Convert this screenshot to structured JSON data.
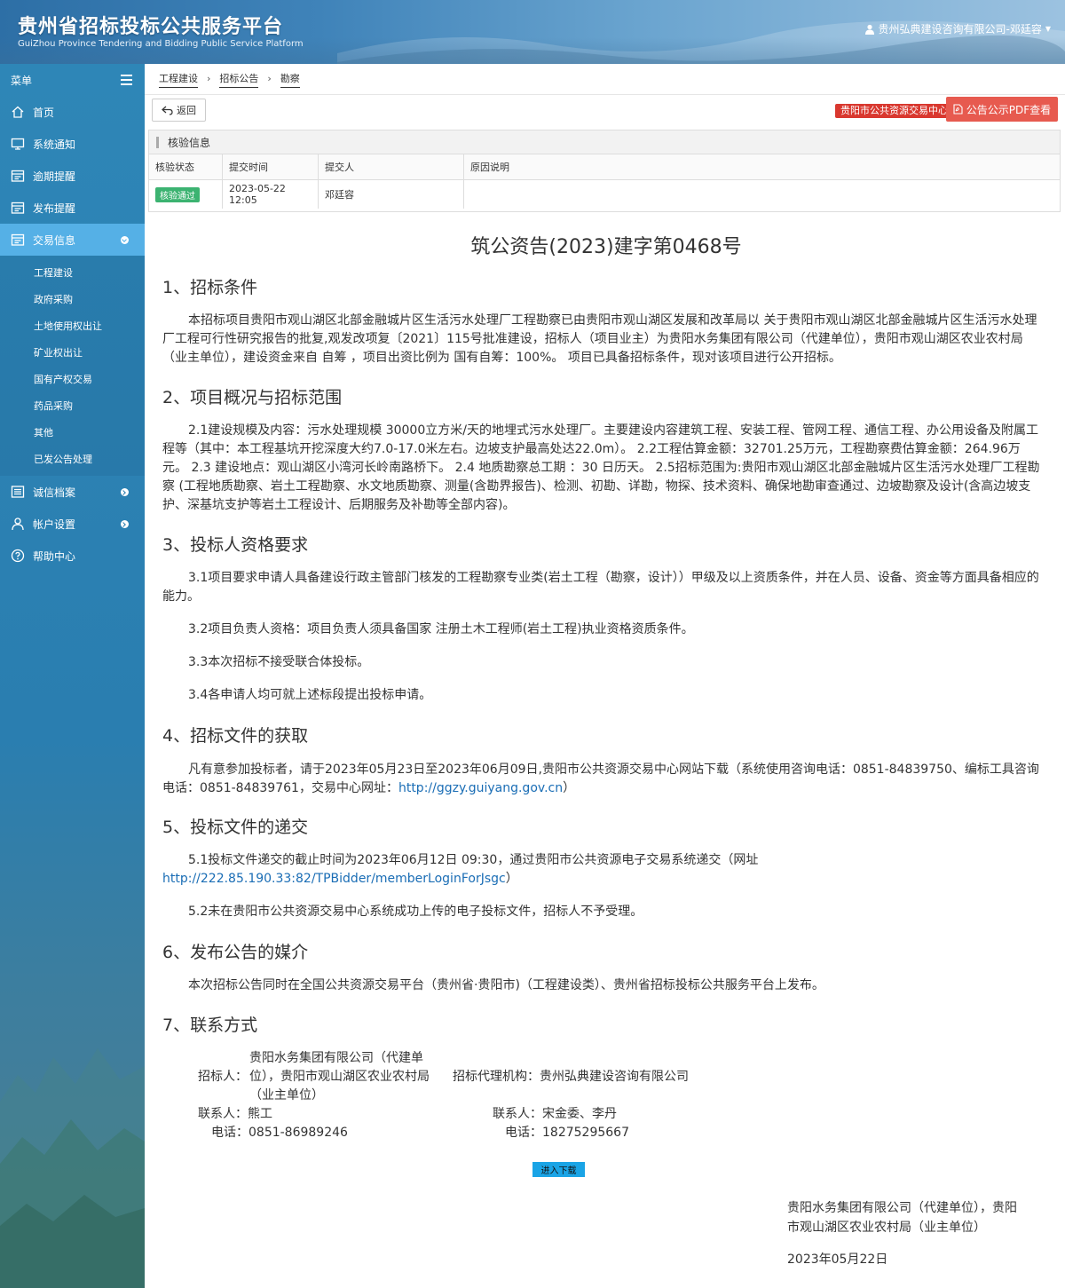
{
  "header": {
    "title_cn": "贵州省招标投标公共服务平台",
    "title_en": "GuiZhou Province Tendering and Bidding Public Service Platform",
    "user": "贵州弘典建设咨询有限公司-邓廷容"
  },
  "sidebar": {
    "menu_label": "菜单",
    "items": [
      {
        "label": "首页",
        "icon": "home-icon"
      },
      {
        "label": "系统通知",
        "icon": "monitor-icon"
      },
      {
        "label": "逾期提醒",
        "icon": "calendar-icon"
      },
      {
        "label": "发布提醒",
        "icon": "calendar-icon"
      },
      {
        "label": "交易信息",
        "icon": "calendar-icon"
      },
      {
        "label": "诚信档案",
        "icon": "list-icon"
      },
      {
        "label": "帐户设置",
        "icon": "user-icon"
      },
      {
        "label": "帮助中心",
        "icon": "help-icon"
      }
    ],
    "sub_items": [
      "工程建设",
      "政府采购",
      "土地使用权出让",
      "矿业权出让",
      "国有产权交易",
      "药品采购",
      "其他",
      "已发公告处理"
    ]
  },
  "breadcrumb": [
    "工程建设",
    "招标公告",
    "勘察"
  ],
  "toolbar": {
    "back_label": "返回",
    "center_tag": "贵阳市公共资源交易中心",
    "pdf_label": "公告公示PDF查看"
  },
  "verify": {
    "title": "核验信息",
    "headers": [
      "核验状态",
      "提交时间",
      "提交人",
      "原因说明"
    ],
    "row": {
      "status": "核验通过",
      "time": "2023-05-22 12:05",
      "submitter": "邓廷容",
      "reason": ""
    }
  },
  "doc": {
    "title": "筑公资告(2023)建字第0468号",
    "s1_title": "1、招标条件",
    "s1_p": "本招标项目贵阳市观山湖区北部金融城片区生活污水处理厂工程勘察已由贵阳市观山湖区发展和改革局以 关于贵阳市观山湖区北部金融城片区生活污水处理厂工程可行性研究报告的批复,观发改项复〔2021〕115号批准建设，招标人（项目业主）为贵阳水务集团有限公司（代建单位），贵阳市观山湖区农业农村局（业主单位），建设资金来自 自筹 ，项目出资比例为 国有自筹：100%。 项目已具备招标条件，现对该项目进行公开招标。",
    "s2_title": "2、项目概况与招标范围",
    "s2_p": "2.1建设规模及内容：污水处理规模 30000立方米/天的地埋式污水处理厂。主要建设内容建筑工程、安装工程、管网工程、通信工程、办公用设备及附属工程等（其中：本工程基坑开挖深度大约7.0-17.0米左右。边坡支护最高处达22.0m）。 2.2工程估算金额：32701.25万元，工程勘察费估算金额：264.96万元。 2.3 建设地点：观山湖区小湾河长岭南路桥下。 2.4 地质勘察总工期 ：30 日历天。 2.5招标范围为:贵阳市观山湖区北部金融城片区生活污水处理厂工程勘察 (工程地质勘察、岩土工程勘察、水文地质勘察、测量(含勘界报告)、检测、初勘、详勘，物探、技术资料、确保地勘审查通过、边坡勘察及设计(含高边坡支护、深基坑支护等岩土工程设计、后期服务及补勘等全部内容)。",
    "s3_title": "3、投标人资格要求",
    "s3_p1": "3.1项目要求申请人具备建设行政主管部门核发的工程勘察专业类(岩土工程（勘察，设计））甲级及以上资质条件，并在人员、设备、资金等方面具备相应的能力。",
    "s3_p2": "3.2项目负责人资格：项目负责人须具备国家 注册土木工程师(岩土工程)执业资格资质条件。",
    "s3_p3": "3.3本次招标不接受联合体投标。",
    "s3_p4": "3.4各申请人均可就上述标段提出投标申请。",
    "s4_title": "4、招标文件的获取",
    "s4_p_a": "凡有意参加投标者，请于2023年05月23日至2023年06月09日,贵阳市公共资源交易中心网站下载（系统使用咨询电话：0851-84839750、编标工具咨询电话：0851-84839761，交易中心网址：",
    "s4_link": "http://ggzy.guiyang.gov.cn",
    "s4_p_b": "）",
    "s5_title": "5、投标文件的递交",
    "s5_p1_a": "5.1投标文件递交的截止时间为2023年06月12日 09:30，通过贵阳市公共资源电子交易系统递交（网址",
    "s5_link": "http://222.85.190.33:82/TPBidder/memberLoginForJsgc",
    "s5_p1_b": "）",
    "s5_p2": "5.2未在贵阳市公共资源交易中心系统成功上传的电子投标文件，招标人不予受理。",
    "s6_title": "6、发布公告的媒介",
    "s6_p": "本次招标公告同时在全国公共资源交易平台（贵州省·贵阳市)（工程建设类）、贵州省招标投标公共服务平台上发布。",
    "s7_title": "7、联系方式",
    "tenderer_label": "招标人：",
    "tenderer_line1": "贵阳水务集团有限公司（代建单",
    "tenderer_line2": "位），贵阳市观山湖区农业农村局",
    "tenderer_line3": "（业主单位）",
    "agency_label": "招标代理机构：",
    "agency": "贵州弘典建设咨询有限公司",
    "contact1_label": "联系人：",
    "contact1": "熊工",
    "phone1_label": "电话：",
    "phone1": "0851-86989246",
    "contact2_label": "联系人：",
    "contact2": "宋金委、李丹",
    "phone2_label": "电话：",
    "phone2": "18275295667",
    "download_label": "进入下载",
    "sign_line1": "贵阳水务集团有限公司（代建单位），贵阳",
    "sign_line2": "市观山湖区农业农村局（业主单位）",
    "sign_date": "2023年05月22日"
  },
  "colors": {
    "sidebar": "#2a7eb0",
    "active": "#55b0e6",
    "pdf_button": "#e75a4f",
    "tag": "#d9382f",
    "ok": "#3cb371",
    "download": "#1aa4e6"
  }
}
